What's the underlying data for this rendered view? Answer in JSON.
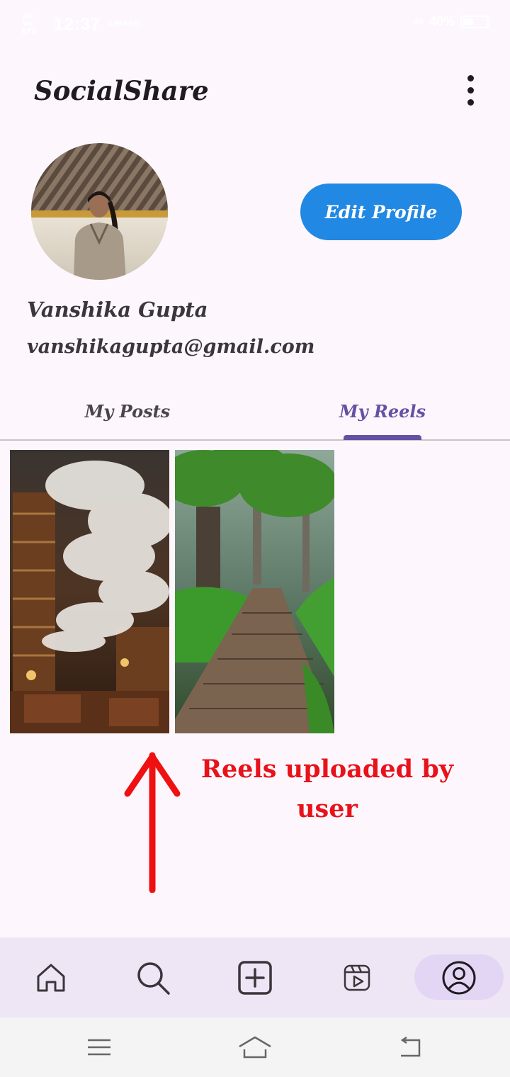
{
  "status_bar": {
    "network_label": "4G",
    "signal_label": "Vo LTE",
    "time": "12:37",
    "speed": "0.00 KB/S",
    "right_network": "4G",
    "battery": "40%",
    "battery_level": 0.4
  },
  "header": {
    "app_title": "SocialShare",
    "menu_icon": "more-vert-icon"
  },
  "profile": {
    "avatar_icon": "profile-photo",
    "edit_button_label": "Edit Profile",
    "name": "Vanshika Gupta",
    "email": "vanshikagupta@gmail.com"
  },
  "tabs": {
    "items": [
      {
        "label": "My Posts",
        "selected": false
      },
      {
        "label": "My Reels",
        "selected": true
      }
    ]
  },
  "reels": {
    "items": [
      {
        "thumbnail": "library-clouds-image"
      },
      {
        "thumbnail": "forest-path-image"
      }
    ]
  },
  "annotation": {
    "text": "Reels uploaded by user",
    "color": "#e8121a"
  },
  "bottom_nav": {
    "items": [
      {
        "icon": "home-icon"
      },
      {
        "icon": "search-icon"
      },
      {
        "icon": "add-post-icon"
      },
      {
        "icon": "reels-icon"
      },
      {
        "icon": "profile-icon",
        "selected": true
      }
    ]
  },
  "system_nav": {
    "items": [
      "menu-icon",
      "home-icon",
      "back-icon"
    ]
  },
  "colors": {
    "background": "#fdf7fd",
    "accent": "#6750a4",
    "button": "#2188e3",
    "nav_background": "#efe6f5"
  }
}
